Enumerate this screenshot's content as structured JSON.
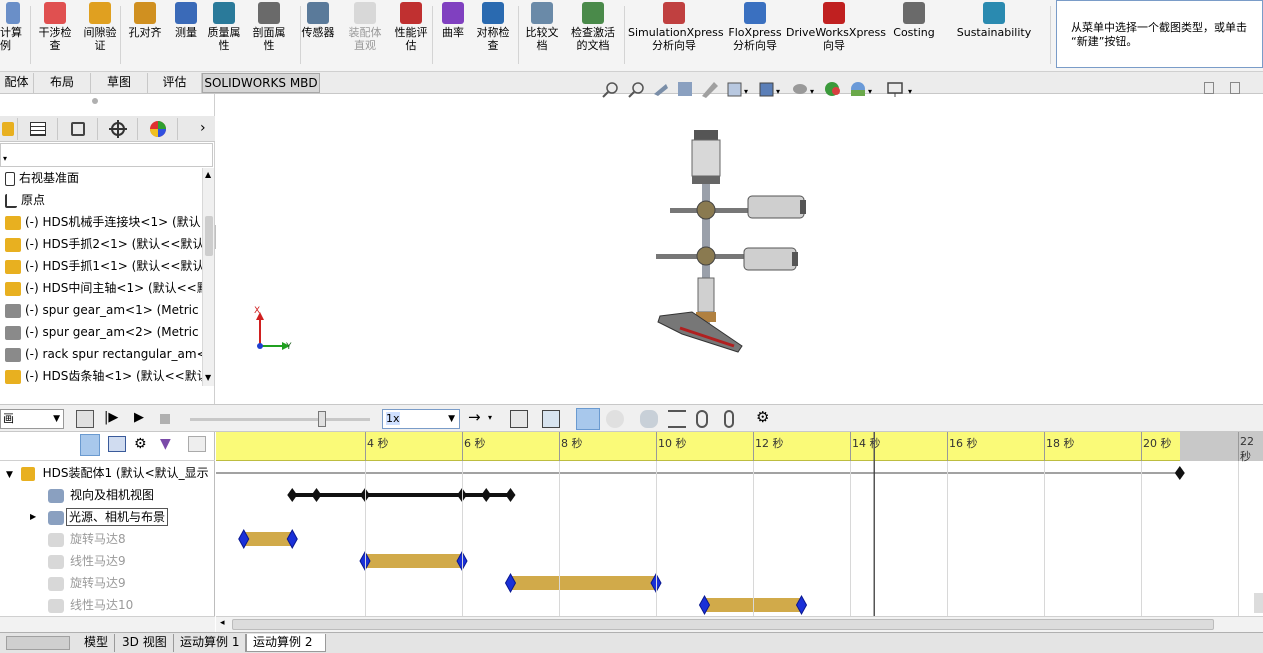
{
  "ribbon": {
    "partial_left_label": "计算\n例",
    "buttons": [
      {
        "label": "干涉检\n查",
        "icon": "interference-check-icon",
        "dim": false
      },
      {
        "label": "间隙验\n证",
        "icon": "clearance-verify-icon",
        "dim": false
      },
      {
        "label": "孔对齐",
        "icon": "hole-align-icon",
        "dim": false
      },
      {
        "label": "测量",
        "icon": "measure-icon",
        "dim": false
      },
      {
        "label": "质量属\n性",
        "icon": "mass-properties-icon",
        "dim": false
      },
      {
        "label": "剖面属\n性",
        "icon": "section-properties-icon",
        "dim": false
      },
      {
        "label": "传感器",
        "icon": "sensor-icon",
        "dim": false
      },
      {
        "label": "装配体\n直观",
        "icon": "assembly-visualization-icon",
        "dim": true
      },
      {
        "label": "性能评\n估",
        "icon": "performance-evaluation-icon",
        "dim": false
      },
      {
        "label": "曲率",
        "icon": "curvature-icon",
        "dim": false
      },
      {
        "label": "对称检\n查",
        "icon": "symmetry-check-icon",
        "dim": false
      },
      {
        "label": "比较文\n档",
        "icon": "compare-documents-icon",
        "dim": false
      },
      {
        "label": "检查激活\n的文档",
        "icon": "check-active-document-icon",
        "dim": false
      },
      {
        "label": "SimulationXpress\n分析向导",
        "icon": "simulationxpress-icon",
        "dim": false
      },
      {
        "label": "FloXpress\n分析向导",
        "icon": "floxpress-icon",
        "dim": false
      },
      {
        "label": "DriveWorksXpress\n向导",
        "icon": "driveworksxpress-icon",
        "dim": false
      },
      {
        "label": "Costing",
        "icon": "costing-icon",
        "dim": false
      },
      {
        "label": "Sustainability",
        "icon": "sustainability-icon",
        "dim": false
      }
    ],
    "hint_text": "从菜单中选择一个截图类型，或单击\n“新建”按钮。"
  },
  "tabs": [
    "配体",
    "布局",
    "草图",
    "评估",
    "SOLIDWORKS MBD"
  ],
  "active_tab_index": 3,
  "feature_tree": {
    "items": [
      {
        "label": "右视基准面",
        "icon": "plane-icon"
      },
      {
        "label": "原点",
        "icon": "origin-icon"
      },
      {
        "label": "(-) HDS机械手连接块<1> (默认",
        "icon": "part-icon"
      },
      {
        "label": "(-) HDS手抓2<1> (默认<<默认",
        "icon": "part-icon"
      },
      {
        "label": "(-) HDS手抓1<1> (默认<<默认",
        "icon": "part-icon"
      },
      {
        "label": "(-) HDS中间主轴<1> (默认<<默",
        "icon": "part-icon"
      },
      {
        "label": "(-) spur gear_am<1> (Metric -",
        "icon": "toolbox-part-icon"
      },
      {
        "label": "(-) spur gear_am<2> (Metric -",
        "icon": "toolbox-part-icon"
      },
      {
        "label": "(-) rack spur rectangular_am<",
        "icon": "toolbox-part-icon"
      },
      {
        "label": "(-) HDS齿条轴<1> (默认<<默认",
        "icon": "part-icon"
      }
    ]
  },
  "triad": {
    "x": "X",
    "y": "Y"
  },
  "motion_toolbar": {
    "study_type": "画",
    "playback_speed": "1x"
  },
  "motion_tree": {
    "root": "HDS装配体1 (默认<默认_显示",
    "items": [
      {
        "label": "视向及相机视图",
        "dim": false
      },
      {
        "label": "光源、相机与布景",
        "dim": false
      },
      {
        "label": "旋转马达8",
        "dim": true
      },
      {
        "label": "线性马达9",
        "dim": true
      },
      {
        "label": "旋转马达9",
        "dim": true
      },
      {
        "label": "线性马达10",
        "dim": true
      }
    ]
  },
  "timeline": {
    "unit": "秒",
    "tick_labels": [
      "4 秒",
      "6 秒",
      "8 秒",
      "10 秒",
      "12 秒",
      "14 秒",
      "16 秒",
      "18 秒",
      "20 秒",
      "22 秒"
    ],
    "tick_values": [
      4,
      6,
      8,
      10,
      12,
      14,
      16,
      18,
      20,
      22
    ],
    "time_bar_sec": 14.5,
    "end_sec": 20.8,
    "view_keys_sec": [
      2.5,
      3.0,
      4.0,
      6.0,
      6.5,
      7.0
    ],
    "bars": [
      {
        "start_sec": 1.5,
        "end_sec": 2.5
      },
      {
        "start_sec": 4.0,
        "end_sec": 6.0
      },
      {
        "start_sec": 7.0,
        "end_sec": 10.0
      },
      {
        "start_sec": 11.0,
        "end_sec": 13.0
      }
    ]
  },
  "bottom_tabs": [
    "模型",
    "3D 视图",
    "运动算例 1",
    "运动算例 2"
  ],
  "active_bottom_tab": 3
}
